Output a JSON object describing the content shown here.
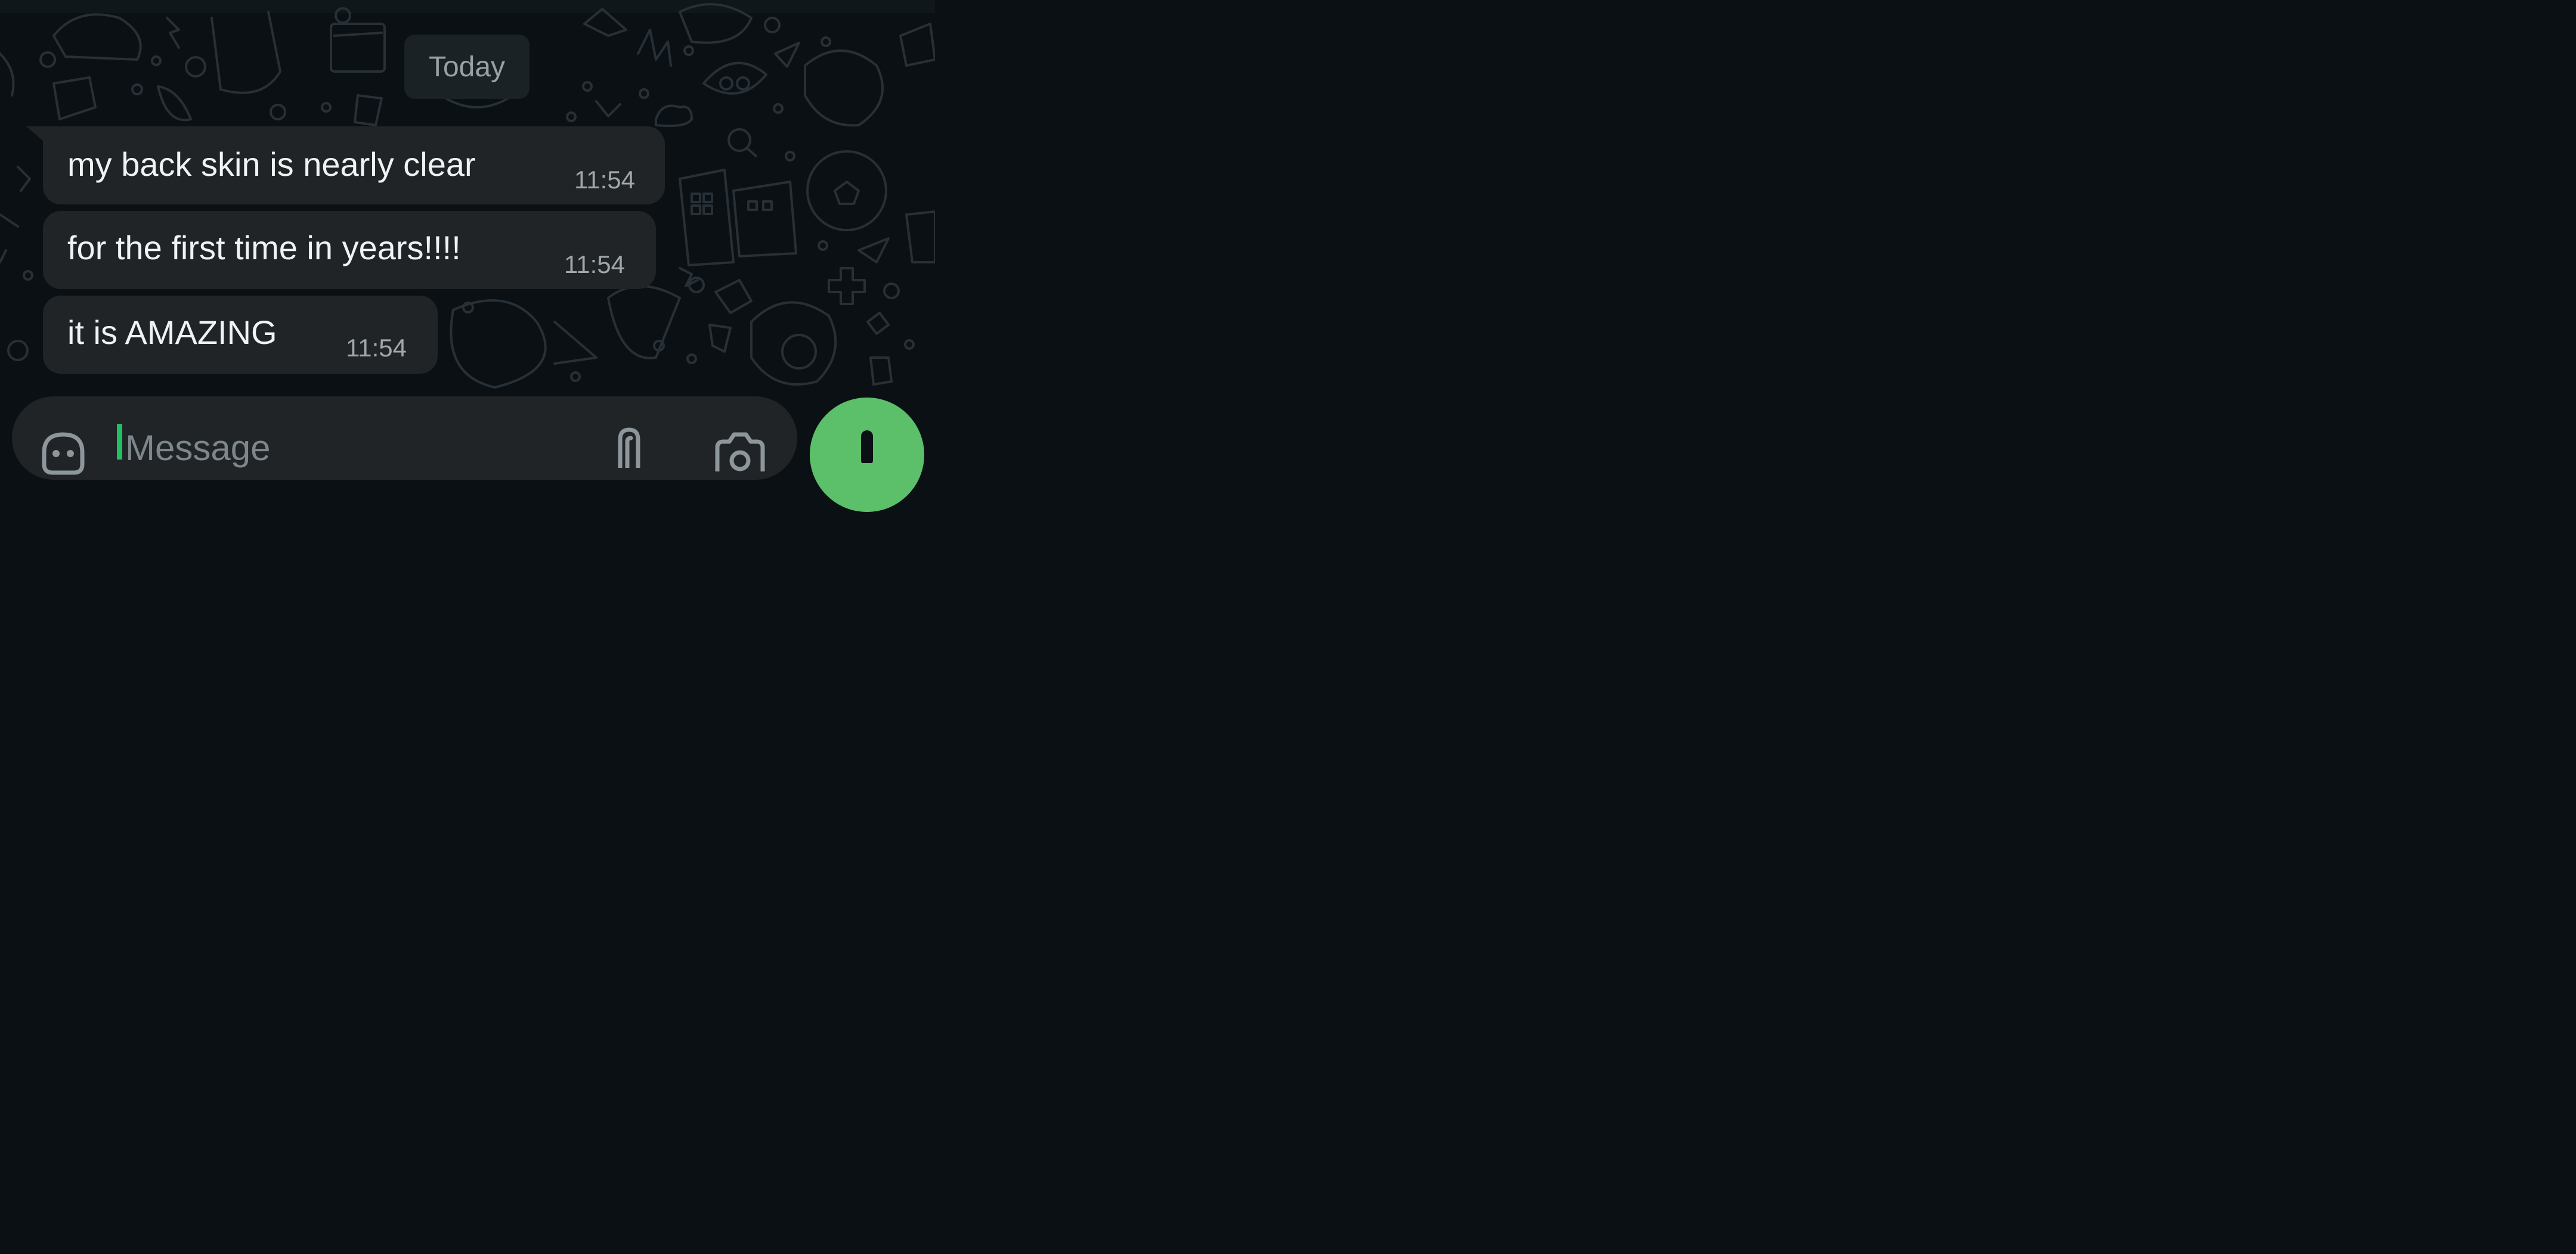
{
  "chat": {
    "date_label": "Today",
    "messages": [
      {
        "text": "my back skin is nearly clear",
        "time": "11:54"
      },
      {
        "text": "for the first time in years!!!!",
        "time": "11:54"
      },
      {
        "text": "it is AMAZING",
        "time": "11:54"
      }
    ]
  },
  "composer": {
    "placeholder": "Message",
    "icons": {
      "emoji": "sticker-icon",
      "attach": "paperclip-icon",
      "camera": "camera-icon",
      "send": "microphone-icon"
    }
  },
  "colors": {
    "background": "#0b1014",
    "bubble": "#202427",
    "accent": "#5cbf6a",
    "cursor": "#21c063"
  }
}
